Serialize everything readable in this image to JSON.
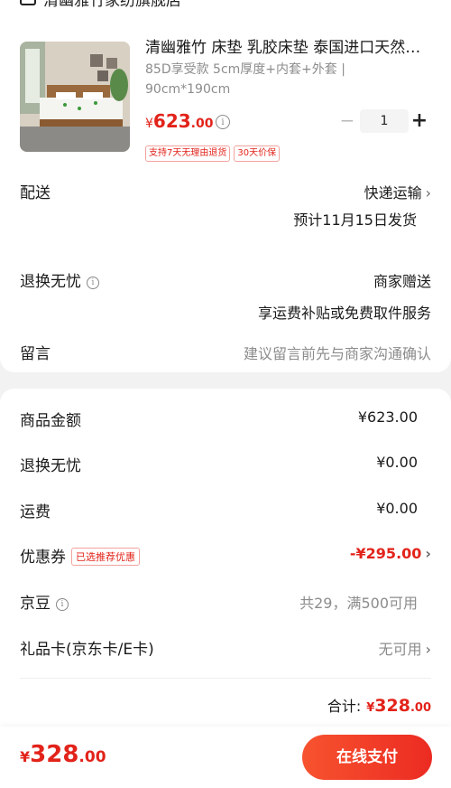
{
  "store": {
    "name": "清幽雅竹家纺旗舰店"
  },
  "product": {
    "title": "清幽雅竹 床垫 乳胶床垫 泰国进口天然乳胶床垫",
    "spec_line1": "85D享受款 5cm厚度+内套+外套 |",
    "spec_line2": "90cm*190cm",
    "price_currency": "¥",
    "price_int": "623",
    "price_dec": ".00",
    "quantity": "1",
    "tags": [
      "支持7天无理由退货",
      "30天价保"
    ]
  },
  "delivery": {
    "label": "配送",
    "method": "快递运输",
    "eta": "预计11月15日发货"
  },
  "return_service": {
    "label": "退换无忧",
    "value": "商家赠送",
    "desc": "享运费补贴或免费取件服务"
  },
  "message": {
    "label": "留言",
    "placeholder": "建议留言前先与商家沟通确认"
  },
  "summary": {
    "goods_label": "商品金额",
    "goods_value": "¥623.00",
    "return_label": "退换无忧",
    "return_value": "¥0.00",
    "shipping_label": "运费",
    "shipping_value": "¥0.00",
    "coupon_label": "优惠券",
    "coupon_badge": "已选推荐优惠",
    "coupon_value": "-¥295.00",
    "beans_label": "京豆",
    "beans_value": "共29，满500可用",
    "giftcard_label": "礼品卡(京东卡/E卡)",
    "giftcard_value": "无可用",
    "total_label": "合计:",
    "total_currency": "¥",
    "total_int": "328",
    "total_dec": ".00"
  },
  "bottom": {
    "currency": "¥",
    "int": "328",
    "dec": ".00",
    "pay_label": "在线支付"
  },
  "colors": {
    "accent": "#e2231a",
    "pay_button": "#f2422a"
  }
}
